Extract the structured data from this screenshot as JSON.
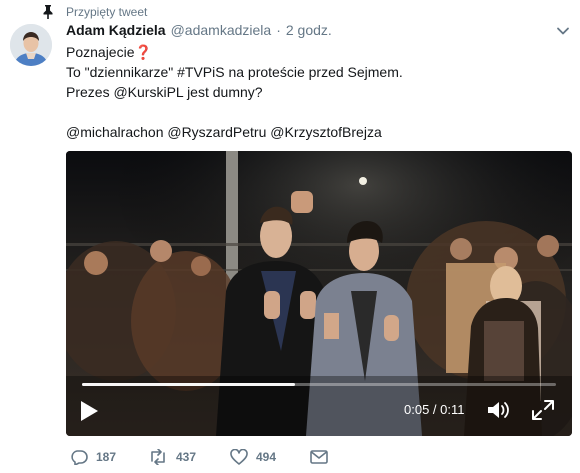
{
  "pinned": {
    "label": "Przypięty tweet",
    "icon": "pin-icon"
  },
  "author": {
    "name": "Adam Kądziela",
    "handle": "@adamkadziela",
    "separator": "·",
    "time": "2 godz."
  },
  "tweet": {
    "lines": [
      "Poznajecie",
      "To \"dziennikarze\" #TVPiS na proteście przed Sejmem.",
      "Prezes @KurskiPL jest dumny?",
      "",
      "@michalrachon @RyszardPetru @KrzysztofBrejza"
    ],
    "emoji": "❓"
  },
  "video": {
    "current_time": "0:05",
    "duration": "0:11",
    "time_separator": " / ",
    "progress": 0.45,
    "controls": [
      "play-icon",
      "volume-icon",
      "fullscreen-icon"
    ]
  },
  "actions": {
    "replies": "187",
    "retweets": "437",
    "likes": "494",
    "icons": [
      "reply-icon",
      "retweet-icon",
      "like-icon",
      "message-icon"
    ]
  },
  "colors": {
    "text": "#14171a",
    "secondary": "#657786",
    "emoji_red": "#e0245e",
    "video_bg": "#141416"
  }
}
